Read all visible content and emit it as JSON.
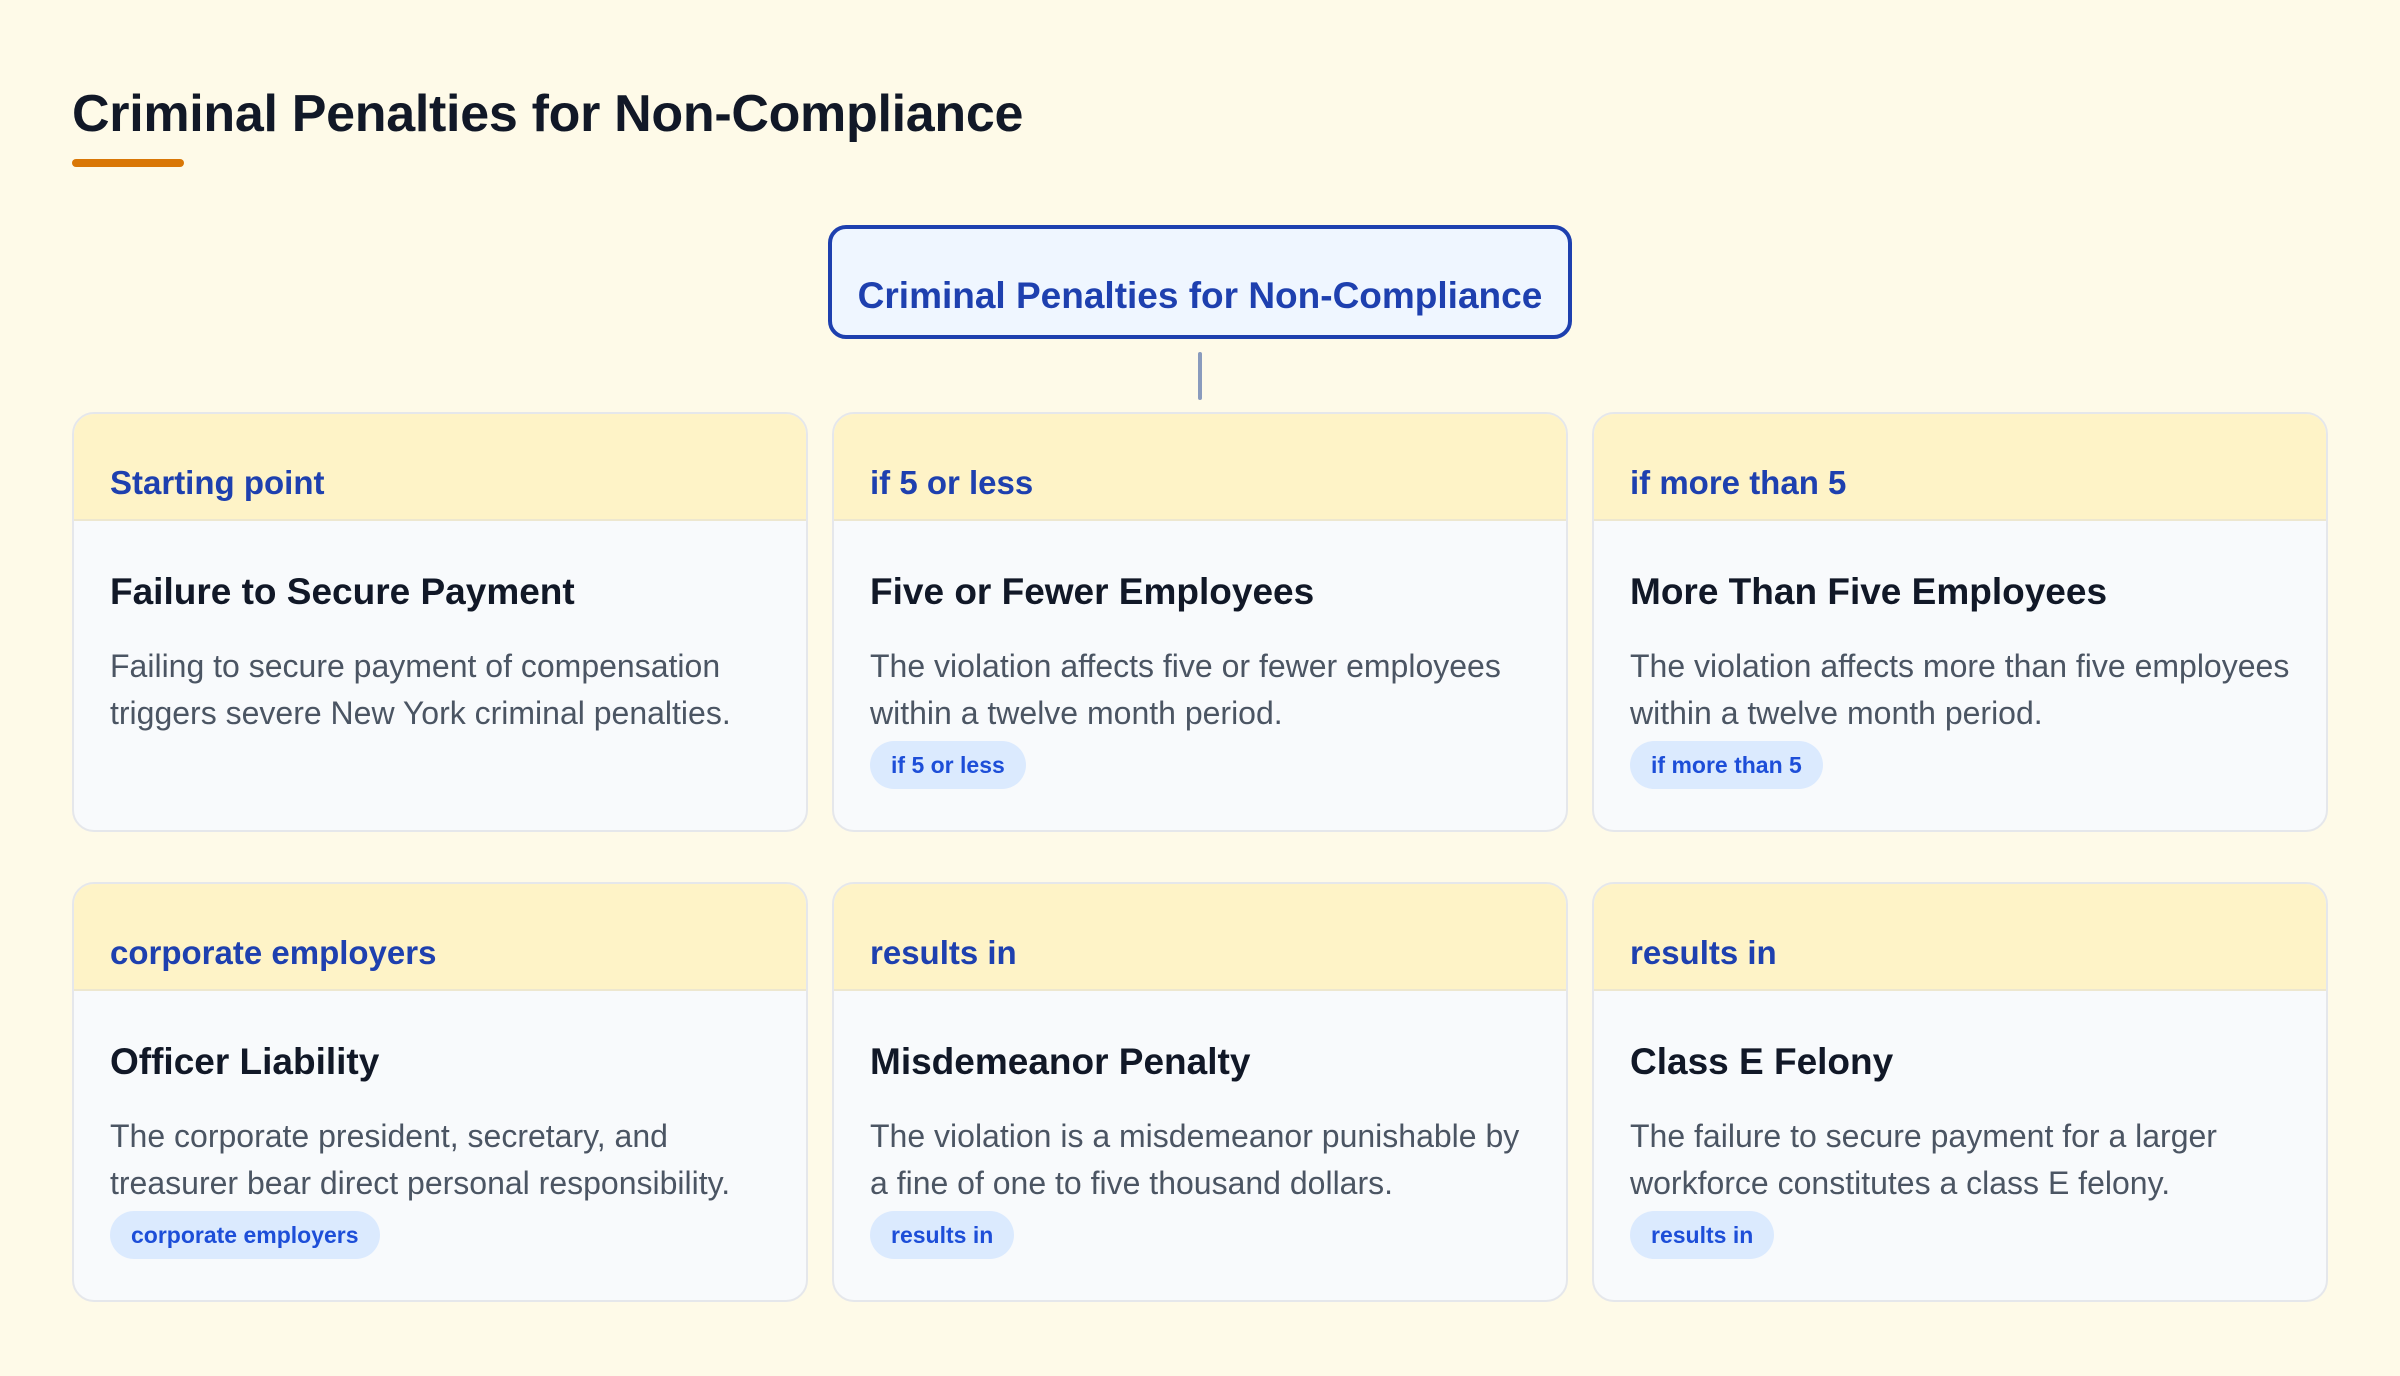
{
  "page": {
    "title": "Criminal Penalties for Non-Compliance",
    "accent_color": "#d97706"
  },
  "root": {
    "label": "Criminal Penalties for Non-Compliance",
    "border_color": "#1e40af"
  },
  "cards": [
    {
      "edge_label": "Starting point",
      "title": "Failure to Secure Payment",
      "description": "Failing to secure payment of compensation triggers severe New York criminal penalties.",
      "badge": ""
    },
    {
      "edge_label": "if 5 or less",
      "title": "Five or Fewer Employees",
      "description": "The violation affects five or fewer employees within a twelve month period.",
      "badge": "if 5 or less"
    },
    {
      "edge_label": "if more than 5",
      "title": "More Than Five Employees",
      "description": "The violation affects more than five employees within a twelve month period.",
      "badge": "if more than 5"
    },
    {
      "edge_label": "corporate employers",
      "title": "Officer Liability",
      "description": "The corporate president, secretary, and treasurer bear direct personal responsibility.",
      "badge": "corporate employers"
    },
    {
      "edge_label": "results in",
      "title": "Misdemeanor Penalty",
      "description": "The violation is a misdemeanor punishable by a fine of one to five thousand dollars.",
      "badge": "results in"
    },
    {
      "edge_label": "results in",
      "title": "Class E Felony",
      "description": "The failure to secure payment for a larger workforce constitutes a class E felony.",
      "badge": "results in"
    }
  ]
}
